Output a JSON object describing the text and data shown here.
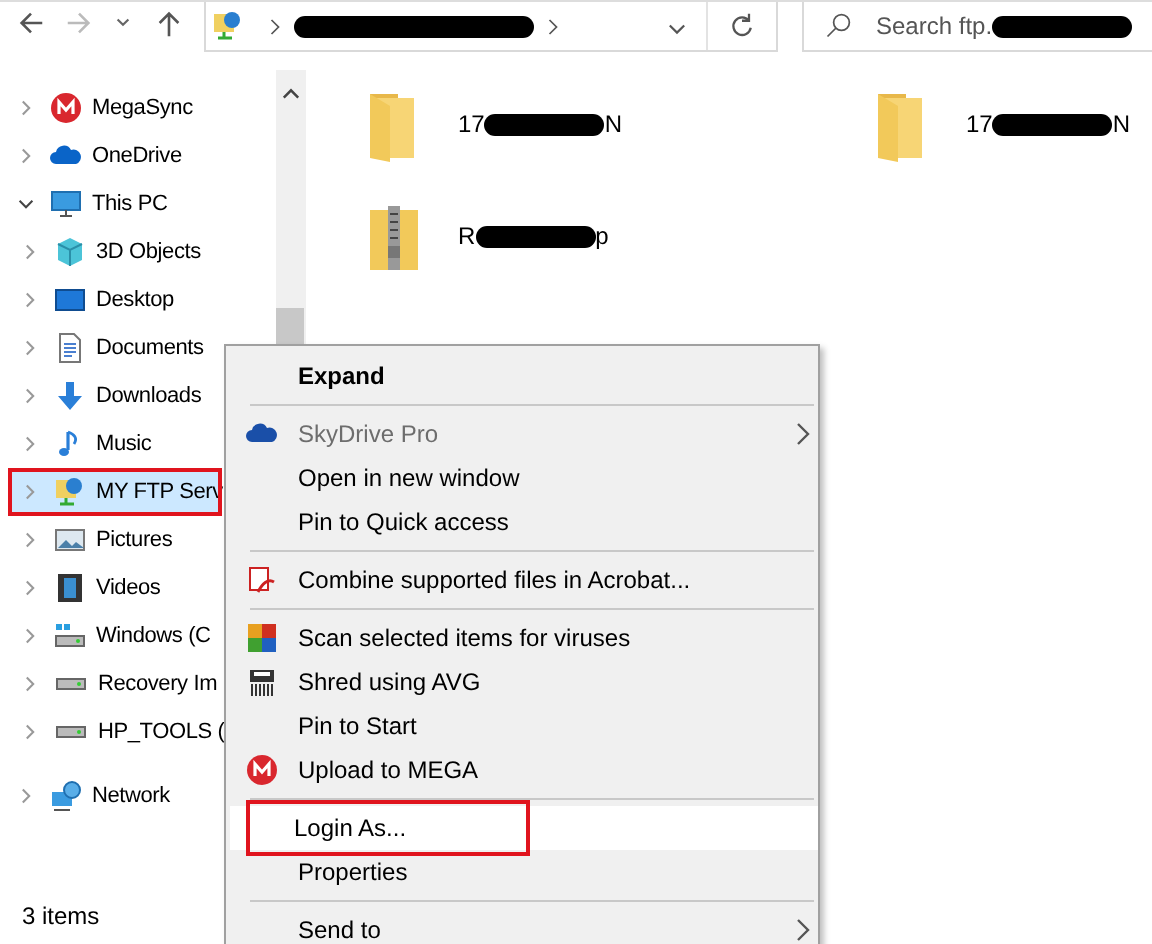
{
  "search": {
    "placeholder": "Search ftp."
  },
  "sidebar": {
    "items": [
      {
        "label": "MegaSync",
        "expanded": false,
        "selected": false,
        "annotated": false
      },
      {
        "label": "OneDrive",
        "expanded": false,
        "selected": false,
        "annotated": false
      },
      {
        "label": "This PC",
        "expanded": true,
        "selected": false,
        "annotated": false,
        "children": [
          {
            "label": "3D Objects",
            "expanded": false,
            "selected": false,
            "annotated": false
          },
          {
            "label": "Desktop",
            "expanded": false,
            "selected": false,
            "annotated": false
          },
          {
            "label": "Documents",
            "expanded": false,
            "selected": false,
            "annotated": false
          },
          {
            "label": "Downloads",
            "expanded": false,
            "selected": false,
            "annotated": false
          },
          {
            "label": "Music",
            "expanded": false,
            "selected": false,
            "annotated": false
          },
          {
            "label": "MY FTP Serv",
            "expanded": false,
            "selected": true,
            "annotated": true
          },
          {
            "label": "Pictures",
            "expanded": false,
            "selected": false,
            "annotated": false
          },
          {
            "label": "Videos",
            "expanded": false,
            "selected": false,
            "annotated": false
          },
          {
            "label": "Windows (C",
            "expanded": false,
            "selected": false,
            "annotated": false
          },
          {
            "label": "Recovery Im",
            "expanded": false,
            "selected": false,
            "annotated": false
          },
          {
            "label": "HP_TOOLS (",
            "expanded": false,
            "selected": false,
            "annotated": false
          }
        ]
      },
      {
        "label": "Network",
        "expanded": false,
        "selected": false,
        "annotated": false
      }
    ]
  },
  "files": [
    {
      "kind": "folder",
      "name_start": "17",
      "name_end": "N"
    },
    {
      "kind": "folder",
      "name_start": "17",
      "name_end": "N"
    },
    {
      "kind": "zip",
      "name_start": "R",
      "name_end": "p"
    }
  ],
  "context_menu": {
    "items": [
      {
        "kind": "item",
        "label": "Expand",
        "bold": true,
        "disabled": false,
        "submenu": false,
        "hovered": false,
        "annotated": false
      },
      {
        "kind": "separator"
      },
      {
        "kind": "item",
        "label": "SkyDrive Pro",
        "bold": false,
        "disabled": true,
        "submenu": true,
        "hovered": false,
        "annotated": false
      },
      {
        "kind": "item",
        "label": "Open in new window",
        "bold": false,
        "disabled": false,
        "submenu": false,
        "hovered": false,
        "annotated": false
      },
      {
        "kind": "item",
        "label": "Pin to Quick access",
        "bold": false,
        "disabled": false,
        "submenu": false,
        "hovered": false,
        "annotated": false
      },
      {
        "kind": "separator"
      },
      {
        "kind": "item",
        "label": "Combine supported files in Acrobat...",
        "bold": false,
        "disabled": false,
        "submenu": false,
        "hovered": false,
        "annotated": false
      },
      {
        "kind": "separator"
      },
      {
        "kind": "item",
        "label": "Scan selected items for viruses",
        "bold": false,
        "disabled": false,
        "submenu": false,
        "hovered": false,
        "annotated": false
      },
      {
        "kind": "item",
        "label": "Shred using AVG",
        "bold": false,
        "disabled": false,
        "submenu": false,
        "hovered": false,
        "annotated": false
      },
      {
        "kind": "item",
        "label": "Pin to Start",
        "bold": false,
        "disabled": false,
        "submenu": false,
        "hovered": false,
        "annotated": false
      },
      {
        "kind": "item",
        "label": "Upload to MEGA",
        "bold": false,
        "disabled": false,
        "submenu": false,
        "hovered": false,
        "annotated": false
      },
      {
        "kind": "separator"
      },
      {
        "kind": "item",
        "label": "Login As...",
        "bold": false,
        "disabled": false,
        "submenu": false,
        "hovered": true,
        "annotated": true
      },
      {
        "kind": "item",
        "label": "Properties",
        "bold": false,
        "disabled": false,
        "submenu": false,
        "hovered": false,
        "annotated": false
      },
      {
        "kind": "separator"
      },
      {
        "kind": "item",
        "label": "Send to",
        "bold": false,
        "disabled": false,
        "submenu": true,
        "hovered": false,
        "annotated": false
      }
    ]
  },
  "status_bar": {
    "text": "3 items"
  }
}
